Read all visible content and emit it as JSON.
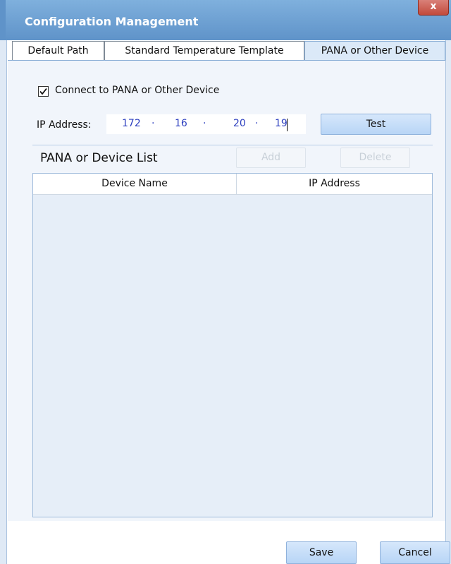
{
  "window": {
    "title": "Configuration Management",
    "close_glyph": "x"
  },
  "tabs": [
    {
      "label": "Default Path",
      "active": false
    },
    {
      "label": "Standard Temperature Template",
      "active": false
    },
    {
      "label": "PANA or Other Device",
      "active": true
    }
  ],
  "connect": {
    "checked": true,
    "label": "Connect to PANA or Other Device"
  },
  "ip": {
    "label": "IP Address:",
    "octets": [
      "172",
      "16",
      "20",
      "19"
    ],
    "separator": "·",
    "test_label": "Test"
  },
  "device_list": {
    "title": "PANA or Device List",
    "add_label": "Add",
    "delete_label": "Delete",
    "columns": [
      "Device Name",
      "IP Address"
    ],
    "rows": []
  },
  "footer": {
    "save_label": "Save",
    "cancel_label": "Cancel"
  },
  "colors": {
    "titlebar": "#5f93c9",
    "accent_button": "#b8d5f6",
    "ip_text": "#2d3fbf",
    "close_button": "#c24a3c"
  },
  "icons": {
    "close": "close-icon",
    "checkbox": "checkmark-icon"
  }
}
